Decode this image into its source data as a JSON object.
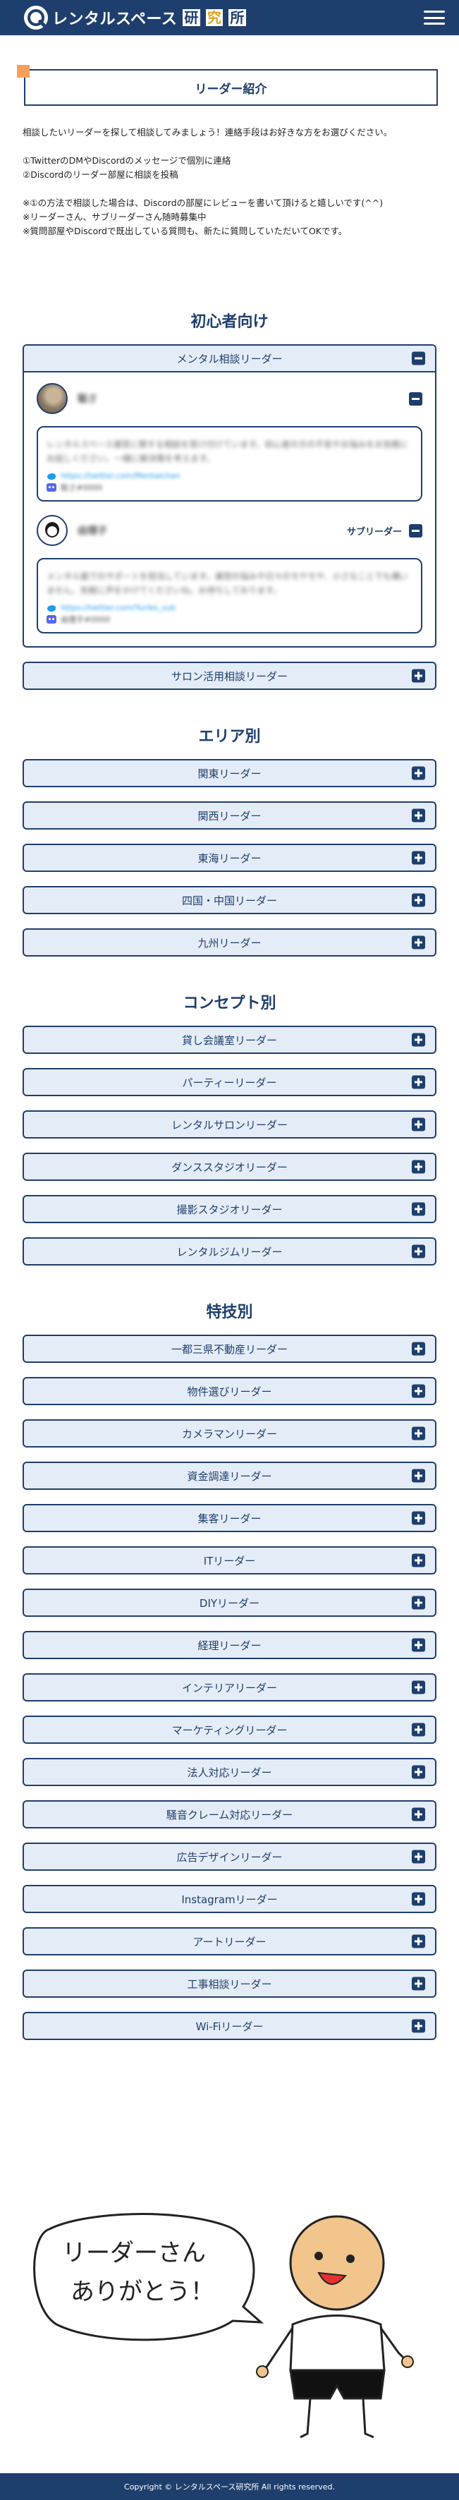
{
  "header": {
    "logo_text": "レンタルスペース",
    "logo_box1": "研",
    "logo_box2": "究",
    "logo_box3": "所"
  },
  "intro": {
    "title": "リーダー紹介",
    "lines": [
      "相談したいリーダーを探して相談してみましょう！連絡手段はお好きな方をお選びください。",
      "",
      "①TwitterのDMやDiscordのメッセージで個別に連絡",
      "②Discordのリーダー部屋に相談を投稿",
      "",
      "※①の方法で相談した場合は、Discordの部屋にレビューを書いて頂けると嬉しいです(^^)",
      "※リーダーさん、サブリーダーさん随時募集中",
      "※質問部屋やDiscordで既出している質問も、新たに質問していただいてOKです。"
    ]
  },
  "beginner": {
    "title": "初心者向け",
    "open_label": "メンタル相談リーダー",
    "leaders": [
      {
        "name": "聡さ",
        "sub_label": "",
        "bio": "レンタルスペース運営に関する相談を受け付けています。初心者の方の不安やお悩みをお気軽にお話しください。一緒に解決策を考えます。",
        "twitter": "https://twitter.com/Mentalchan",
        "discord": "聡さ#0000"
      },
      {
        "name": "由理子",
        "sub_label": "サブリーダー",
        "bio": "メンタル面でのサポートを担当しています。運営の悩みや日々のモヤモヤ、小さなことでも構いません。気軽に声をかけてくださいね。お待ちしております。",
        "twitter": "https://twitter.com/Yuriko_sub",
        "discord": "由理子#0000"
      }
    ],
    "closed": [
      "サロン活用相談リーダー"
    ]
  },
  "area": {
    "title": "エリア別",
    "items": [
      "関東リーダー",
      "関西リーダー",
      "東海リーダー",
      "四国・中国リーダー",
      "九州リーダー"
    ]
  },
  "concept": {
    "title": "コンセプト別",
    "items": [
      "貸し会議室リーダー",
      "パーティーリーダー",
      "レンタルサロンリーダー",
      "ダンススタジオリーダー",
      "撮影スタジオリーダー",
      "レンタルジムリーダー"
    ]
  },
  "skill": {
    "title": "特技別",
    "items": [
      "一都三県不動産リーダー",
      "物件選びリーダー",
      "カメラマンリーダー",
      "資金調達リーダー",
      "集客リーダー",
      "ITリーダー",
      "DIYリーダー",
      "経理リーダー",
      "インテリアリーダー",
      "マーケティングリーダー",
      "法人対応リーダー",
      "騒音クレーム対応リーダー",
      "広告デザインリーダー",
      "Instagramリーダー",
      "アートリーダー",
      "工事相談リーダー",
      "Wi-Fiリーダー"
    ]
  },
  "illustration": {
    "speech_line1": "リーダーさん",
    "speech_line2": "ありがとう！"
  },
  "footer": {
    "copyright": "Copyright © レンタルスペース研究所 All rights reserved."
  }
}
